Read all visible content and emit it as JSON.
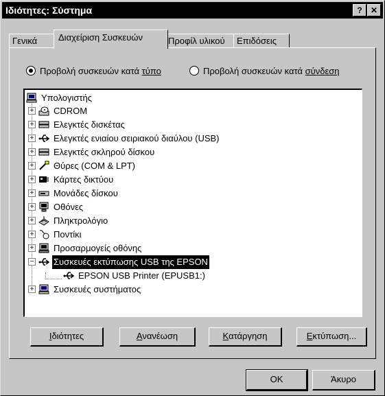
{
  "window": {
    "title": "Ιδιότητες: Σύστημα",
    "help_glyph": "?",
    "close_glyph": "✕"
  },
  "tabs": [
    {
      "label": "Γενικά",
      "active": false
    },
    {
      "label": "Διαχείριση Συσκευών",
      "active": true
    },
    {
      "label": "Προφίλ υλικού",
      "active": false
    },
    {
      "label": "Επιδόσεις",
      "active": false
    }
  ],
  "view": {
    "by_type": {
      "label_pre": "Προβολή συσκευών κατά ",
      "label_key": "τύπο",
      "checked": true
    },
    "by_connection": {
      "label_pre": "Προβολή συσκευών κατά ",
      "label_key": "σύνδεση",
      "checked": false
    }
  },
  "tree": {
    "root": {
      "label": "Υπολογιστής",
      "icon": "computer-icon"
    },
    "items": [
      {
        "label": "CDROM",
        "icon": "cdrom-icon"
      },
      {
        "label": "Ελεγκτές δισκέτας",
        "icon": "disk-controller-icon"
      },
      {
        "label": "Ελεγκτές ενιαίου σειριακού διαύλου (USB)",
        "icon": "usb-icon"
      },
      {
        "label": "Ελεγκτές σκληρού δίσκου",
        "icon": "disk-controller-icon"
      },
      {
        "label": "Θύρες (COM & LPT)",
        "icon": "port-icon"
      },
      {
        "label": "Κάρτες δικτύου",
        "icon": "network-card-icon"
      },
      {
        "label": "Μονάδες δίσκου",
        "icon": "disk-drive-icon"
      },
      {
        "label": "Οθόνες",
        "icon": "monitor-icon"
      },
      {
        "label": "Πληκτρολόγιο",
        "icon": "keyboard-icon"
      },
      {
        "label": "Ποντίκι",
        "icon": "mouse-icon"
      },
      {
        "label": "Προσαρμογείς οθόνης",
        "icon": "display-adapter-icon"
      },
      {
        "label": "Συσκευές εκτύπωσης USB της EPSON",
        "icon": "usb-icon",
        "expanded": true,
        "selected": true
      },
      {
        "label": "EPSON USB Printer (EPUSB1:)",
        "icon": "usb-icon",
        "child": true
      },
      {
        "label": "Συσκευές συστήματος",
        "icon": "computer-icon"
      }
    ]
  },
  "buttons": {
    "properties": {
      "key": "Ι",
      "rest": "διότητες"
    },
    "refresh": {
      "key": "Α",
      "rest": "νανέωση"
    },
    "remove": {
      "key": "Κ",
      "rest": "ατάργηση"
    },
    "print": {
      "key": "Ε",
      "rest": "κτύπωση..."
    },
    "ok": "OK",
    "cancel": "Άκυρο"
  }
}
